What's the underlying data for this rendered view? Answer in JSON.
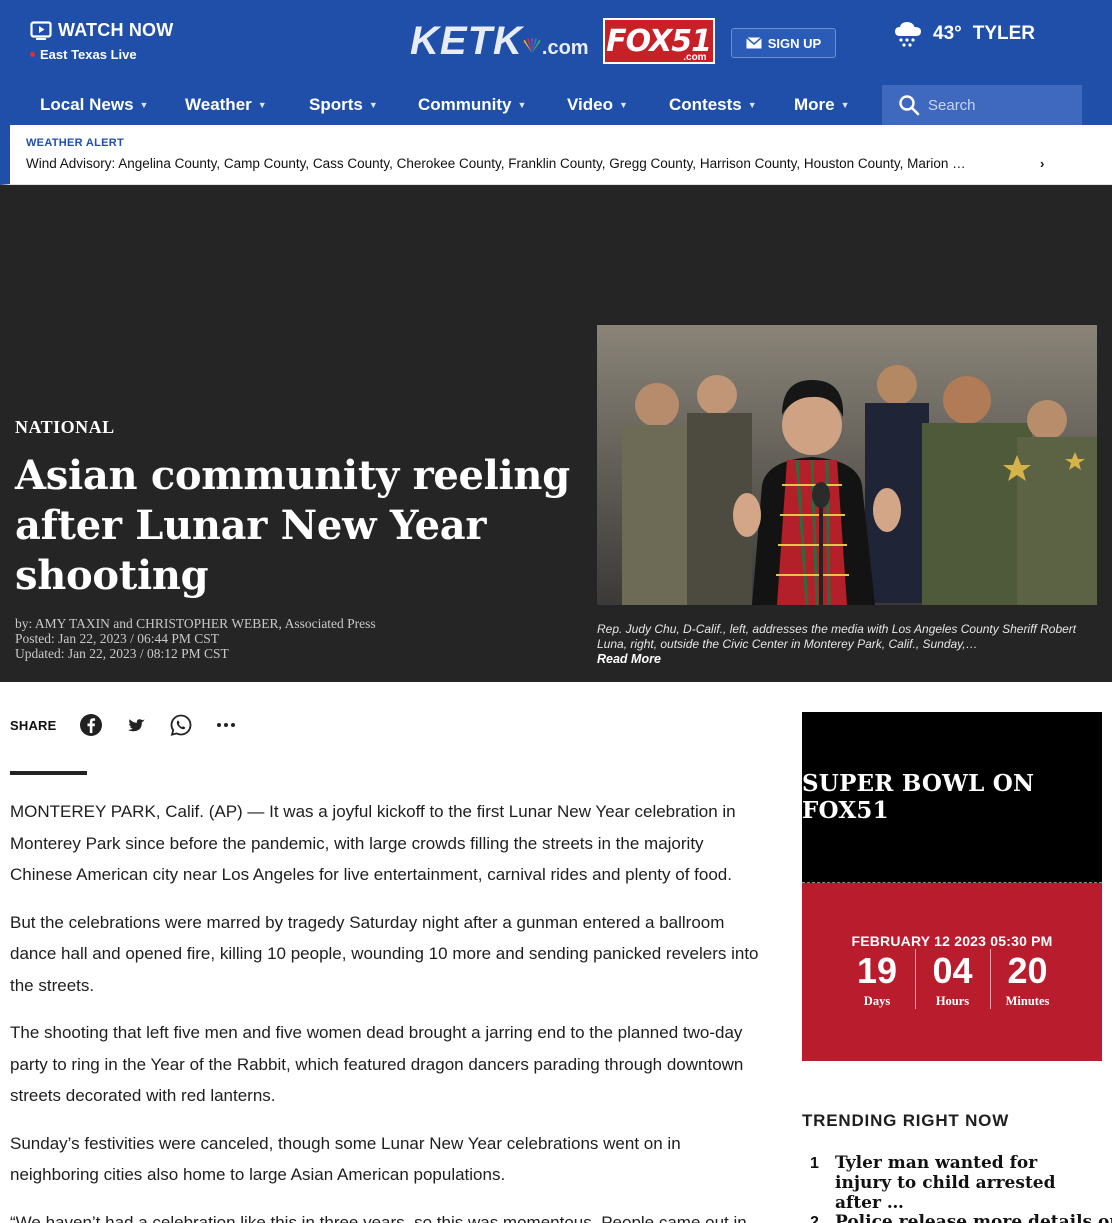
{
  "header": {
    "watch_label": "WATCH NOW",
    "watch_sub": "East Texas Live",
    "logo_ketk": "KETK",
    "logo_ketk_com": ".com",
    "logo_fox": "FOX51",
    "logo_fox_com": ".com",
    "signup_label": "SIGN UP",
    "weather_temp": "43°",
    "weather_city": "TYLER",
    "weather_icon": "rain-cloud-icon"
  },
  "nav": {
    "items": [
      {
        "label": "Local News"
      },
      {
        "label": "Weather"
      },
      {
        "label": "Sports"
      },
      {
        "label": "Community"
      },
      {
        "label": "Video"
      },
      {
        "label": "Contests"
      },
      {
        "label": "More"
      }
    ],
    "caret": "▼",
    "search_placeholder": "Search"
  },
  "alert": {
    "label": "WEATHER ALERT",
    "text": "Wind Advisory: Angelina County, Camp County, Cass County, Cherokee County, Franklin County, Gregg County, Harrison County, Houston County, Marion …",
    "chevron": "›"
  },
  "hero": {
    "category": "NATIONAL",
    "title": "Asian community reeling after Lunar New Year shooting",
    "byline": "by: AMY TAXIN and CHRISTOPHER WEBER, Associated Press",
    "posted": "Posted: Jan 22, 2023 / 06:44 PM CST",
    "updated": "Updated: Jan 22, 2023 / 08:12 PM CST",
    "caption": "Rep. Judy Chu, D-Calif., left, addresses the media with Los Angeles County Sheriff Robert Luna, right, outside the Civic Center in Monterey Park, Calif., Sunday,…",
    "read_more": "Read More"
  },
  "share": {
    "label": "SHARE",
    "icons": [
      "facebook-icon",
      "twitter-icon",
      "whatsapp-icon",
      "more-icon"
    ]
  },
  "article": {
    "paragraphs": [
      "MONTEREY PARK, Calif. (AP) — It was a joyful kickoff to the first Lunar New Year celebration in Monterey Park since before the pandemic, with large crowds filling the streets in the majority Chinese American city near Los Angeles for live entertainment, carnival rides and plenty of food.",
      "But the celebrations were marred by tragedy Saturday night after a gunman entered a ballroom dance hall and opened fire, killing 10 people, wounding 10 more and sending panicked revelers into the streets.",
      "The shooting that left five men and five women dead brought a jarring end to the planned two-day party to ring in the Year of the Rabbit, which featured dragon dancers parading through downtown streets decorated with red lanterns.",
      "Sunday’s festivities were canceled, though some Lunar New Year celebrations went on in neighboring cities also home to large Asian American populations.",
      "“We haven’t had a celebration like this in three years, so this was momentous. People came out in"
    ]
  },
  "promo": {
    "title": "SUPER BOWL ON FOX51",
    "date": "FEBRUARY 12 2023 05:30 PM",
    "countdown": [
      {
        "value": "19",
        "label": "Days"
      },
      {
        "value": "04",
        "label": "Hours"
      },
      {
        "value": "20",
        "label": "Minutes"
      }
    ]
  },
  "trending": {
    "heading": "TRENDING RIGHT NOW",
    "items": [
      {
        "num": "1",
        "title": "Tyler man wanted for injury to child arrested after …"
      },
      {
        "num": "2",
        "title": "Police release more details on"
      }
    ]
  },
  "colors": {
    "brand_blue": "#1f4fa8",
    "hero_bg": "#252525",
    "promo_red": "#b91c2c"
  }
}
